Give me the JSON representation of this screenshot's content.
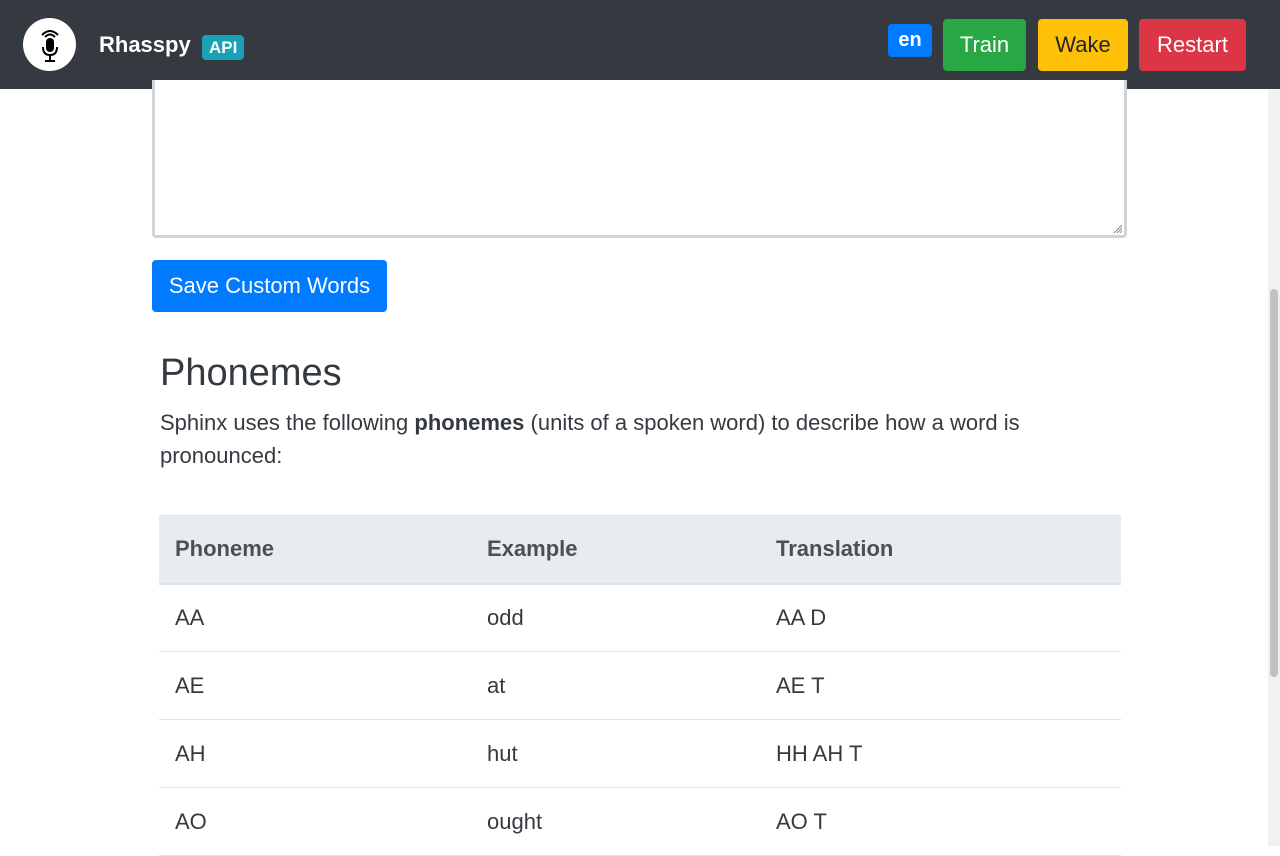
{
  "navbar": {
    "brand": "Rhasspy",
    "api_badge": "API",
    "language": "en",
    "train_label": "Train",
    "wake_label": "Wake",
    "restart_label": "Restart",
    "logo_icon": "microphone-icon"
  },
  "custom_words": {
    "textarea_value": "",
    "save_label": "Save Custom Words"
  },
  "phonemes_section": {
    "title": "Phonemes",
    "desc_before": "Sphinx uses the following ",
    "desc_bold": "phonemes",
    "desc_after": " (units of a spoken word) to describe how a word is pronounced:"
  },
  "table": {
    "headers": [
      "Phoneme",
      "Example",
      "Translation"
    ],
    "rows": [
      [
        "AA",
        "odd",
        "AA D"
      ],
      [
        "AE",
        "at",
        "AE T"
      ],
      [
        "AH",
        "hut",
        "HH AH T"
      ],
      [
        "AO",
        "ought",
        "AO T"
      ]
    ]
  },
  "colors": {
    "navbar_bg": "#343a40",
    "primary": "#007bff",
    "success": "#28a745",
    "warning": "#ffc107",
    "danger": "#dc3545",
    "info": "#17a2b8"
  }
}
